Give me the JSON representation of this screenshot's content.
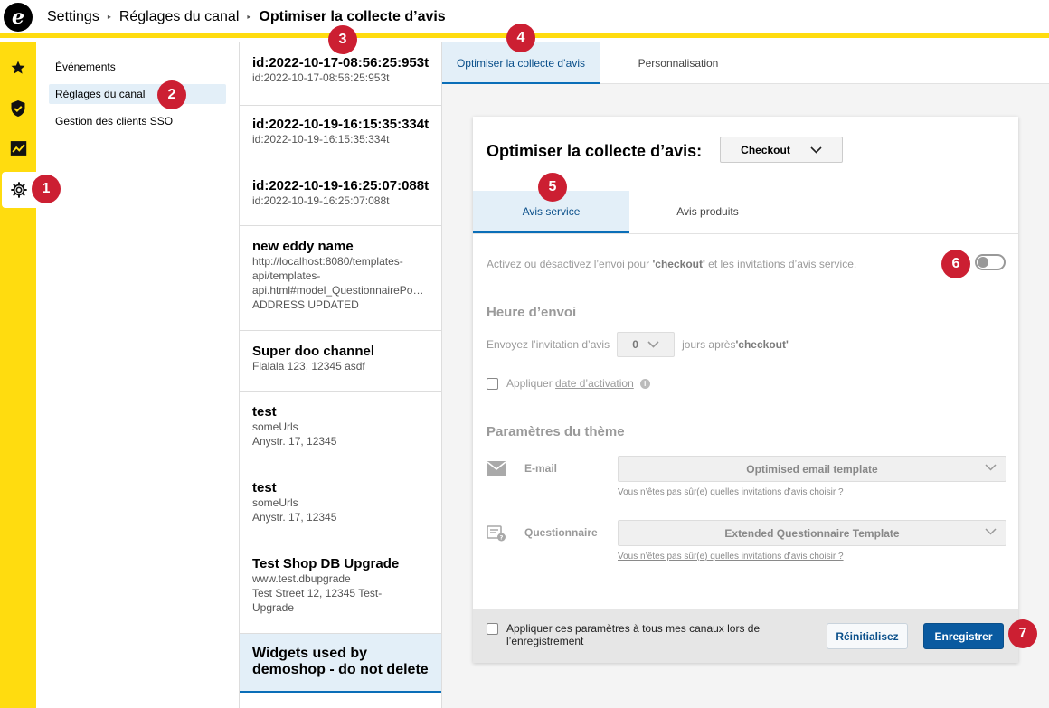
{
  "header": {
    "logo_letter": "e",
    "breadcrumb": [
      "Settings",
      "Réglages du canal",
      "Optimiser la collecte d’avis"
    ]
  },
  "sidebar_icons": [
    "star-icon",
    "shield-check-icon",
    "chart-trend-icon",
    "gear-icon"
  ],
  "nav": {
    "items": [
      "Événements",
      "Réglages du canal",
      "Gestion des clients SSO"
    ]
  },
  "channels": [
    {
      "title": "id:2022-10-17-08:56:25:953t",
      "lines": [
        "id:2022-10-17-08:56:25:953t"
      ]
    },
    {
      "title": "id:2022-10-19-16:15:35:334t",
      "lines": [
        "id:2022-10-19-16:15:35:334t"
      ]
    },
    {
      "title": "id:2022-10-19-16:25:07:088t",
      "lines": [
        "id:2022-10-19-16:25:07:088t"
      ]
    },
    {
      "title": "new eddy name",
      "lines": [
        "http://localhost:8080/templates-",
        "api/templates-",
        "api.html#model_QuestionnairePo…",
        "ADDRESS UPDATED"
      ]
    },
    {
      "title": "Super doo channel",
      "lines": [
        "Flalala 123, 12345 asdf"
      ]
    },
    {
      "title": "test",
      "lines": [
        "someUrls",
        "Anystr. 17, 12345"
      ]
    },
    {
      "title": "test",
      "lines": [
        "someUrls",
        "Anystr. 17, 12345"
      ]
    },
    {
      "title": "Test Shop DB Upgrade",
      "lines": [
        "www.test.dbupgrade",
        "Test Street 12, 12345 Test-",
        "Upgrade"
      ]
    },
    {
      "title_lines": [
        "Widgets used by",
        "demoshop - do not delete!"
      ],
      "lines": []
    }
  ],
  "tabs": [
    "Optimiser la collecte d’avis",
    "Personnalisation"
  ],
  "card": {
    "title": "Optimiser la collecte d’avis:",
    "select_value": "Checkout",
    "subtabs": [
      "Avis service",
      "Avis produits"
    ],
    "toggle_text_1": "Activez ou désactivez l’envoi pour ",
    "toggle_text_bold": "'checkout'",
    "toggle_text_2": " et les invitations d’avis service.",
    "toggle_on": false,
    "send_heading": "Heure d’envoi",
    "send_prefix": "Envoyez l’invitation d’avis",
    "send_days": "0",
    "send_suffix": "jours après ",
    "send_suffix_bold": "'checkout'",
    "activation_prefix": "Appliquer ",
    "activation_link": "date d’activation",
    "info_glyph": "i",
    "theme_heading": "Paramètres du thème",
    "email_label": "E-mail",
    "email_template": "Optimised email template",
    "email_help": "Vous n’êtes pas sûr(e) quelles invitations d’avis choisir ?",
    "quest_label": "Questionnaire",
    "quest_template": "Extended Questionnaire Template",
    "quest_help": "Vous n’êtes pas sûr(e) quelles invitations d’avis choisir ?",
    "apply_all": "Appliquer ces paramètres à tous mes canaux lors de l’enregistrement",
    "reset_label": "Réinitialisez",
    "save_label": "Enregistrer"
  },
  "markers": [
    "1",
    "2",
    "3",
    "4",
    "5",
    "6",
    "7"
  ],
  "colors": {
    "accent_yellow": "#ffdc0f",
    "primary_blue": "#0a5aa0",
    "marker_red": "#cc1f32",
    "selected_bg": "#e3eff8"
  }
}
